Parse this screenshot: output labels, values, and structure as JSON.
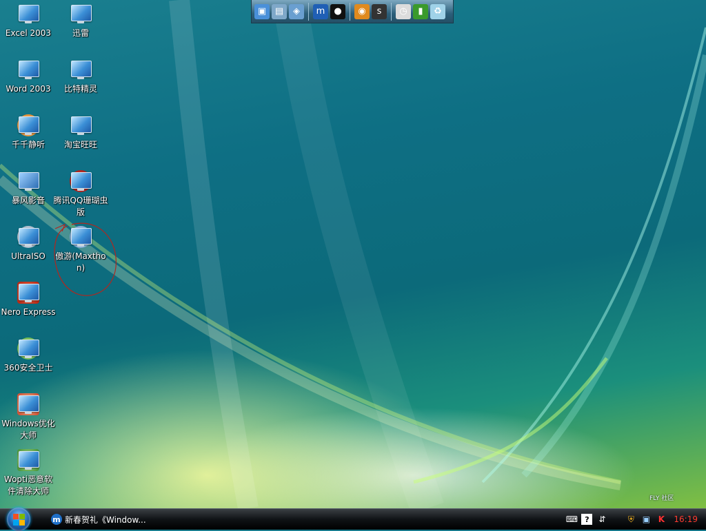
{
  "quicklaunch": {
    "icons": [
      {
        "name": "show-desktop-icon",
        "glyph": "▣",
        "color": "#4a90d9"
      },
      {
        "name": "folder-icon",
        "glyph": "▤",
        "color": "#7fa8c9"
      },
      {
        "name": "ie-icon",
        "glyph": "◈",
        "color": "#6a9fd0"
      },
      {
        "name": "maxthon-icon",
        "glyph": "m",
        "color": "#1f5fb5"
      },
      {
        "name": "qq-icon",
        "glyph": "●",
        "color": "#111111"
      },
      {
        "name": "music-player-icon",
        "glyph": "◉",
        "color": "#e08a1e"
      },
      {
        "name": "flash-icon",
        "glyph": "s",
        "color": "#333333"
      },
      {
        "name": "clock-icon",
        "glyph": "◷",
        "color": "#dcdcdc"
      },
      {
        "name": "monitor-meter-icon",
        "glyph": "▮",
        "color": "#3a9a2c"
      },
      {
        "name": "recycle-bin-icon",
        "glyph": "♻",
        "color": "#9fd2e8"
      }
    ]
  },
  "desktop": {
    "icons": [
      {
        "label": "Excel 2003"
      },
      {
        "label": "迅雷"
      },
      {
        "label": "Word 2003"
      },
      {
        "label": "比特精灵"
      },
      {
        "label": "千千静听"
      },
      {
        "label": "淘宝旺旺"
      },
      {
        "label": "暴风影音"
      },
      {
        "label": "腾讯QQ珊瑚虫版"
      },
      {
        "label": "UltraISO"
      },
      {
        "label": "傲游(Maxthon)"
      },
      {
        "label": "Nero Express"
      },
      {
        "label": "360安全卫士"
      },
      {
        "label": "Windows优化大师"
      },
      {
        "label": "Wopti恶意软件清除大师"
      }
    ]
  },
  "watermark": "FLY 社区",
  "taskbar": {
    "task_label": "新春贺礼《Window...",
    "task_icon_glyph": "m",
    "clock": "16:19"
  },
  "colors": {
    "annotation": "#b3261e",
    "clock": "#ff3b30"
  }
}
